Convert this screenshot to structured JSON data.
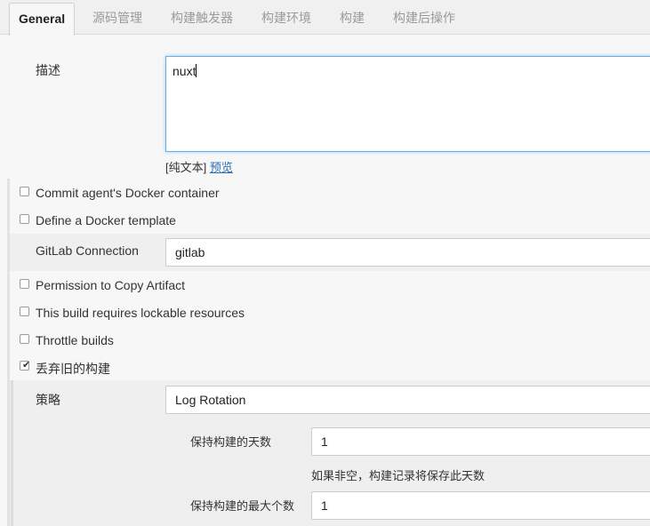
{
  "tabs": [
    {
      "label": "General",
      "active": true
    },
    {
      "label": "源码管理"
    },
    {
      "label": "构建触发器"
    },
    {
      "label": "构建环境"
    },
    {
      "label": "构建"
    },
    {
      "label": "构建后操作"
    }
  ],
  "description": {
    "label": "描述",
    "value": "nuxt",
    "plain_text": "[纯文本]",
    "preview_link": "预览"
  },
  "options": {
    "commit_docker": "Commit agent's Docker container",
    "docker_template": "Define a Docker template",
    "gitlab_connection_label": "GitLab Connection",
    "gitlab_connection_value": "gitlab",
    "copy_artifact": "Permission to Copy Artifact",
    "lockable_resources": "This build requires lockable resources",
    "throttle_builds": "Throttle builds",
    "discard_old_builds": "丢弃旧的构建"
  },
  "discard": {
    "strategy_label": "策略",
    "strategy_value": "Log Rotation",
    "days_label": "保持构建的天数",
    "days_value": "1",
    "days_hint": "如果非空，构建记录将保存此天数",
    "max_builds_label": "保持构建的最大个数",
    "max_builds_value": "1"
  },
  "colors": {
    "focus_border": "#66afe9",
    "link": "#2a6fb4"
  }
}
